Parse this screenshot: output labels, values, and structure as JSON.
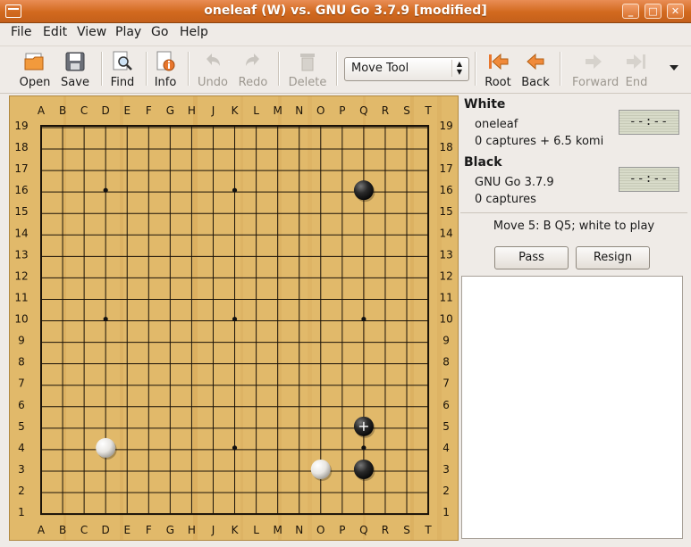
{
  "window": {
    "title": "oneleaf (W) vs. GNU Go 3.7.9 [modified]"
  },
  "menu": [
    "File",
    "Edit",
    "View",
    "Play",
    "Go",
    "Help"
  ],
  "toolbar": {
    "open": "Open",
    "save": "Save",
    "find": "Find",
    "info": "Info",
    "undo": "Undo",
    "redo": "Redo",
    "delete": "Delete",
    "tool_select": "Move Tool",
    "root": "Root",
    "back": "Back",
    "forward": "Forward",
    "end": "End"
  },
  "board": {
    "size": 19,
    "columns": [
      "A",
      "B",
      "C",
      "D",
      "E",
      "F",
      "G",
      "H",
      "J",
      "K",
      "L",
      "M",
      "N",
      "O",
      "P",
      "Q",
      "R",
      "S",
      "T"
    ],
    "rows": [
      "19",
      "18",
      "17",
      "16",
      "15",
      "14",
      "13",
      "12",
      "11",
      "10",
      "9",
      "8",
      "7",
      "6",
      "5",
      "4",
      "3",
      "2",
      "1"
    ],
    "hoshi": [
      "D16",
      "K16",
      "Q16",
      "D10",
      "K10",
      "Q10",
      "D4",
      "K4",
      "Q4"
    ],
    "stones": [
      {
        "pos": "Q16",
        "color": "black"
      },
      {
        "pos": "Q5",
        "color": "black",
        "last": true
      },
      {
        "pos": "Q3",
        "color": "black"
      },
      {
        "pos": "D4",
        "color": "white"
      },
      {
        "pos": "O3",
        "color": "white"
      }
    ],
    "colors": {
      "wood": "#e1b96a",
      "line": "#1a1208"
    }
  },
  "white": {
    "label": "White",
    "name": "oneleaf",
    "captures": "0 captures + 6.5 komi",
    "clock": "--:--"
  },
  "black": {
    "label": "Black",
    "name": "GNU Go 3.7.9",
    "captures": "0 captures",
    "clock": "--:--"
  },
  "status": "Move 5: B Q5; white to play",
  "buttons": {
    "pass": "Pass",
    "resign": "Resign"
  }
}
